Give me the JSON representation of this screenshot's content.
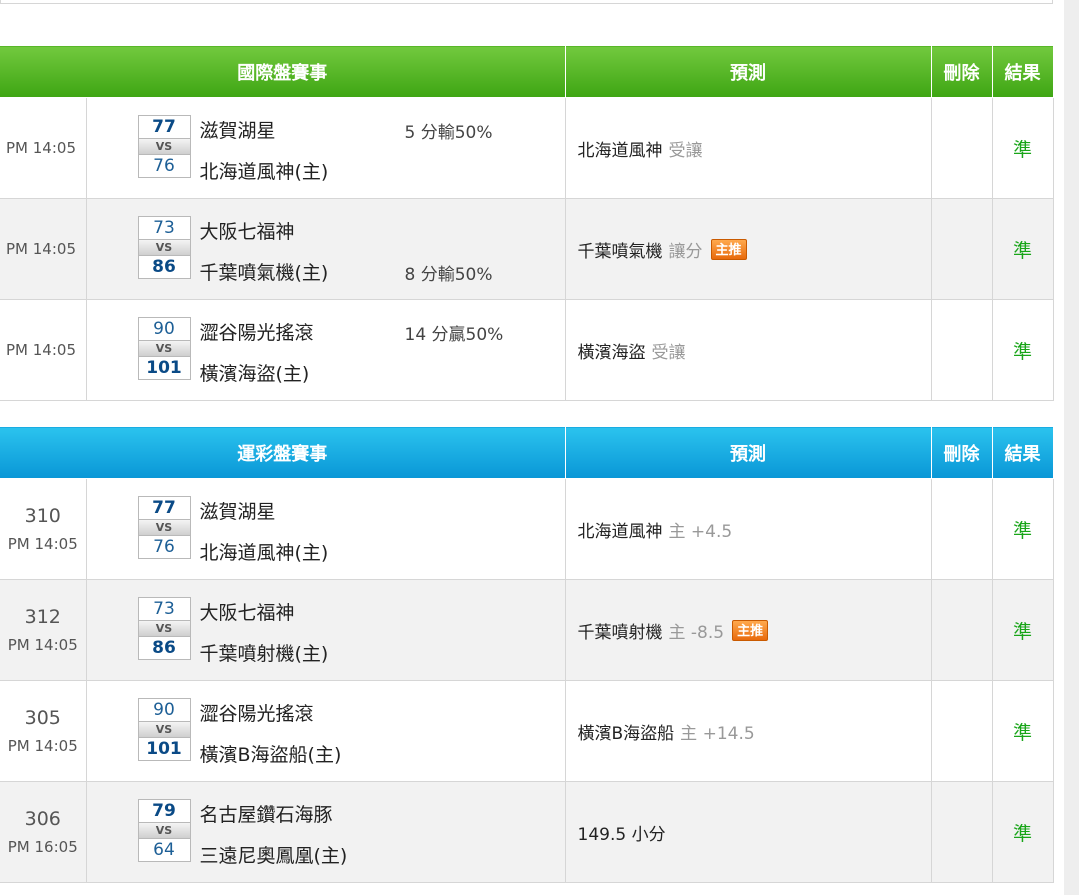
{
  "intl": {
    "headers": {
      "match": "國際盤賽事",
      "predict": "預測",
      "delete": "刪除",
      "result": "結果"
    },
    "rows": [
      {
        "time": "PM 14:05",
        "score1": "77",
        "score2": "76",
        "winner": 1,
        "vs": "VS",
        "team1": "滋賀湖星",
        "team2": "北海道風神(主)",
        "handicap": "5 分輸50%",
        "handicap_row": "top",
        "pred_team": "北海道風神",
        "pred_type": "受讓",
        "badge": "",
        "result": "準"
      },
      {
        "time": "PM 14:05",
        "score1": "73",
        "score2": "86",
        "winner": 2,
        "vs": "VS",
        "team1": "大阪七福神",
        "team2": "千葉噴氣機(主)",
        "handicap": "8 分輸50%",
        "handicap_row": "bot",
        "pred_team": "千葉噴氣機",
        "pred_type": "讓分",
        "badge": "主推",
        "result": "準"
      },
      {
        "time": "PM 14:05",
        "score1": "90",
        "score2": "101",
        "winner": 2,
        "vs": "VS",
        "team1": "澀谷陽光搖滾",
        "team2": "橫濱海盜(主)",
        "handicap": "14 分贏50%",
        "handicap_row": "top",
        "pred_team": "橫濱海盜",
        "pred_type": "受讓",
        "badge": "",
        "result": "準"
      }
    ]
  },
  "lottery": {
    "headers": {
      "match": "運彩盤賽事",
      "predict": "預測",
      "delete": "刪除",
      "result": "結果"
    },
    "rows": [
      {
        "num": "310",
        "time": "PM 14:05",
        "score1": "77",
        "score2": "76",
        "winner": 1,
        "vs": "VS",
        "team1": "滋賀湖星",
        "team2": "北海道風神(主)",
        "pred_team": "北海道風神",
        "pred_type": "主 +4.5",
        "badge": "",
        "result": "準"
      },
      {
        "num": "312",
        "time": "PM 14:05",
        "score1": "73",
        "score2": "86",
        "winner": 2,
        "vs": "VS",
        "team1": "大阪七福神",
        "team2": "千葉噴射機(主)",
        "pred_team": "千葉噴射機",
        "pred_type": "主 -8.5",
        "badge": "主推",
        "result": "準"
      },
      {
        "num": "305",
        "time": "PM 14:05",
        "score1": "90",
        "score2": "101",
        "winner": 2,
        "vs": "VS",
        "team1": "澀谷陽光搖滾",
        "team2": "橫濱B海盜船(主)",
        "pred_team": "橫濱B海盜船",
        "pred_type": "主 +14.5",
        "badge": "",
        "result": "準"
      },
      {
        "num": "306",
        "time": "PM 16:05",
        "score1": "79",
        "score2": "64",
        "winner": 1,
        "vs": "VS",
        "team1": "名古屋鑽石海豚",
        "team2": "三遠尼奧鳳凰(主)",
        "pred_team": "149.5 小分",
        "pred_type": "",
        "badge": "",
        "result": "準"
      }
    ]
  },
  "colors": {
    "intl_header": "#3ea513",
    "lottery_header": "#0996d6",
    "result": "#19a519",
    "badge": "#e86a0c"
  }
}
